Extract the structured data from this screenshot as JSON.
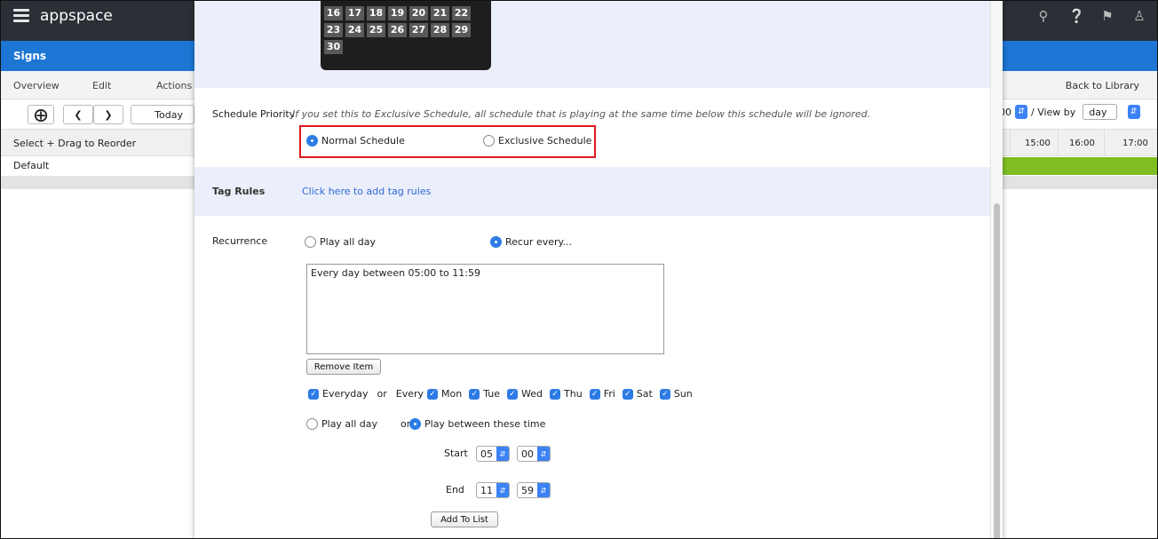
{
  "app": {
    "brand": "appspace",
    "section": "Signs",
    "nav": [
      "Overview",
      "Edit",
      "Actions"
    ],
    "back": "Back to Library",
    "today": "Today",
    "reorder": "Select + Drag to Reorder",
    "default_row": "Default",
    "time_partial": "00",
    "view_by": "/ View by",
    "view_value": "day",
    "times": [
      "15:00",
      "16:00",
      "17:00"
    ]
  },
  "calendar": {
    "rows": [
      [
        "16",
        "17",
        "18",
        "19",
        "20",
        "21",
        "22"
      ],
      [
        "23",
        "24",
        "25",
        "26",
        "27",
        "28",
        "29"
      ],
      [
        "30"
      ]
    ]
  },
  "schedule_priority": {
    "label": "Schedule Priority",
    "note": "If you set this to Exclusive Schedule, all schedule that is playing at the same time below this schedule will be ignored.",
    "normal": "Normal Schedule",
    "exclusive": "Exclusive Schedule"
  },
  "tag_rules": {
    "label": "Tag Rules",
    "link": "Click here to add tag rules"
  },
  "recurrence": {
    "label": "Recurrence",
    "play_all_day": "Play all day",
    "recur_every": "Recur every...",
    "list_text": "Every day between 05:00 to 11:59",
    "remove_item": "Remove Item",
    "everyday": "Everyday",
    "or": "or",
    "every": "Every",
    "days": [
      "Mon",
      "Tue",
      "Wed",
      "Thu",
      "Fri",
      "Sat",
      "Sun"
    ],
    "play_all_day2": "Play all day",
    "play_between": "Play between these time",
    "start_label": "Start",
    "start_hour": "05",
    "start_min": "00",
    "end_label": "End",
    "end_hour": "11",
    "end_min": "59",
    "add_to_list": "Add To List"
  },
  "colors": {
    "accent": "#2d7be5",
    "highlight": "#e0191a"
  }
}
